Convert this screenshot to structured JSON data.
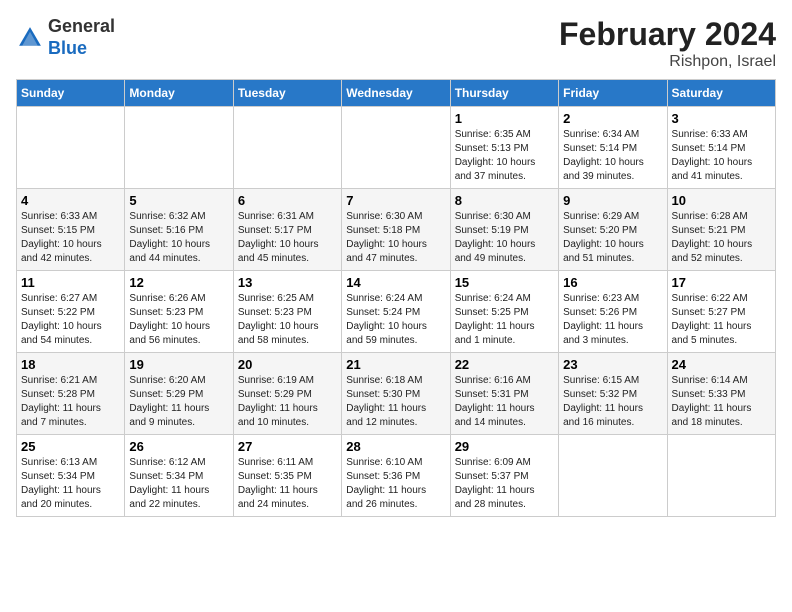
{
  "header": {
    "logo_general": "General",
    "logo_blue": "Blue",
    "month_title": "February 2024",
    "location": "Rishpon, Israel"
  },
  "weekdays": [
    "Sunday",
    "Monday",
    "Tuesday",
    "Wednesday",
    "Thursday",
    "Friday",
    "Saturday"
  ],
  "weeks": [
    [
      {
        "day": "",
        "info": ""
      },
      {
        "day": "",
        "info": ""
      },
      {
        "day": "",
        "info": ""
      },
      {
        "day": "",
        "info": ""
      },
      {
        "day": "1",
        "info": "Sunrise: 6:35 AM\nSunset: 5:13 PM\nDaylight: 10 hours\nand 37 minutes."
      },
      {
        "day": "2",
        "info": "Sunrise: 6:34 AM\nSunset: 5:14 PM\nDaylight: 10 hours\nand 39 minutes."
      },
      {
        "day": "3",
        "info": "Sunrise: 6:33 AM\nSunset: 5:14 PM\nDaylight: 10 hours\nand 41 minutes."
      }
    ],
    [
      {
        "day": "4",
        "info": "Sunrise: 6:33 AM\nSunset: 5:15 PM\nDaylight: 10 hours\nand 42 minutes."
      },
      {
        "day": "5",
        "info": "Sunrise: 6:32 AM\nSunset: 5:16 PM\nDaylight: 10 hours\nand 44 minutes."
      },
      {
        "day": "6",
        "info": "Sunrise: 6:31 AM\nSunset: 5:17 PM\nDaylight: 10 hours\nand 45 minutes."
      },
      {
        "day": "7",
        "info": "Sunrise: 6:30 AM\nSunset: 5:18 PM\nDaylight: 10 hours\nand 47 minutes."
      },
      {
        "day": "8",
        "info": "Sunrise: 6:30 AM\nSunset: 5:19 PM\nDaylight: 10 hours\nand 49 minutes."
      },
      {
        "day": "9",
        "info": "Sunrise: 6:29 AM\nSunset: 5:20 PM\nDaylight: 10 hours\nand 51 minutes."
      },
      {
        "day": "10",
        "info": "Sunrise: 6:28 AM\nSunset: 5:21 PM\nDaylight: 10 hours\nand 52 minutes."
      }
    ],
    [
      {
        "day": "11",
        "info": "Sunrise: 6:27 AM\nSunset: 5:22 PM\nDaylight: 10 hours\nand 54 minutes."
      },
      {
        "day": "12",
        "info": "Sunrise: 6:26 AM\nSunset: 5:23 PM\nDaylight: 10 hours\nand 56 minutes."
      },
      {
        "day": "13",
        "info": "Sunrise: 6:25 AM\nSunset: 5:23 PM\nDaylight: 10 hours\nand 58 minutes."
      },
      {
        "day": "14",
        "info": "Sunrise: 6:24 AM\nSunset: 5:24 PM\nDaylight: 10 hours\nand 59 minutes."
      },
      {
        "day": "15",
        "info": "Sunrise: 6:24 AM\nSunset: 5:25 PM\nDaylight: 11 hours\nand 1 minute."
      },
      {
        "day": "16",
        "info": "Sunrise: 6:23 AM\nSunset: 5:26 PM\nDaylight: 11 hours\nand 3 minutes."
      },
      {
        "day": "17",
        "info": "Sunrise: 6:22 AM\nSunset: 5:27 PM\nDaylight: 11 hours\nand 5 minutes."
      }
    ],
    [
      {
        "day": "18",
        "info": "Sunrise: 6:21 AM\nSunset: 5:28 PM\nDaylight: 11 hours\nand 7 minutes."
      },
      {
        "day": "19",
        "info": "Sunrise: 6:20 AM\nSunset: 5:29 PM\nDaylight: 11 hours\nand 9 minutes."
      },
      {
        "day": "20",
        "info": "Sunrise: 6:19 AM\nSunset: 5:29 PM\nDaylight: 11 hours\nand 10 minutes."
      },
      {
        "day": "21",
        "info": "Sunrise: 6:18 AM\nSunset: 5:30 PM\nDaylight: 11 hours\nand 12 minutes."
      },
      {
        "day": "22",
        "info": "Sunrise: 6:16 AM\nSunset: 5:31 PM\nDaylight: 11 hours\nand 14 minutes."
      },
      {
        "day": "23",
        "info": "Sunrise: 6:15 AM\nSunset: 5:32 PM\nDaylight: 11 hours\nand 16 minutes."
      },
      {
        "day": "24",
        "info": "Sunrise: 6:14 AM\nSunset: 5:33 PM\nDaylight: 11 hours\nand 18 minutes."
      }
    ],
    [
      {
        "day": "25",
        "info": "Sunrise: 6:13 AM\nSunset: 5:34 PM\nDaylight: 11 hours\nand 20 minutes."
      },
      {
        "day": "26",
        "info": "Sunrise: 6:12 AM\nSunset: 5:34 PM\nDaylight: 11 hours\nand 22 minutes."
      },
      {
        "day": "27",
        "info": "Sunrise: 6:11 AM\nSunset: 5:35 PM\nDaylight: 11 hours\nand 24 minutes."
      },
      {
        "day": "28",
        "info": "Sunrise: 6:10 AM\nSunset: 5:36 PM\nDaylight: 11 hours\nand 26 minutes."
      },
      {
        "day": "29",
        "info": "Sunrise: 6:09 AM\nSunset: 5:37 PM\nDaylight: 11 hours\nand 28 minutes."
      },
      {
        "day": "",
        "info": ""
      },
      {
        "day": "",
        "info": ""
      }
    ]
  ]
}
